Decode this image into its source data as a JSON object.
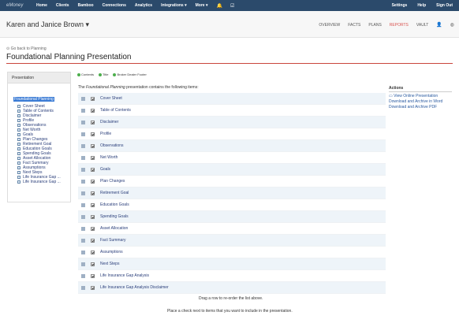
{
  "app": {
    "brand": "eMoney"
  },
  "nav": {
    "items": [
      "Home",
      "Clients",
      "Bamboo",
      "Connections",
      "Analytics",
      "Integrations ▾",
      "More ▾"
    ],
    "right": [
      "Settings",
      "Help",
      "Sign Out"
    ]
  },
  "client": {
    "name": "Karen and Janice Brown ▾",
    "tabs": [
      "OVERVIEW",
      "FACTS",
      "PLANS",
      "REPORTS",
      "VAULT"
    ],
    "active_tab": "REPORTS"
  },
  "page": {
    "back": "Go back to Planning",
    "title": "Foundational Planning Presentation"
  },
  "sidebar": {
    "heading": "Presentation",
    "root": "Foundational Planning",
    "items": [
      "Cover Sheet",
      "Table of Contents",
      "Disclaimer",
      "Profile",
      "Observations",
      "Net Worth",
      "Goals",
      "Plan Changes",
      "Retirement Goal",
      "Education Goals",
      "Spending Goals",
      "Asset Allocation",
      "Fact Summary",
      "Assumptions",
      "Next Steps",
      "Life Insurance Gap ...",
      "Life Insurance Gap ..."
    ]
  },
  "toolbar": {
    "contents": "Contents",
    "title": "Title",
    "footer": "Broker Dealer Footer"
  },
  "content": {
    "intro_pre": "The ",
    "intro_em": "Foundational Planning",
    "intro_post": " presentation contains the following items:",
    "rows": [
      "Cover Sheet",
      "Table of Contents",
      "Disclaimer",
      "Profile",
      "Observations",
      "Net Worth",
      "Goals",
      "Plan Changes",
      "Retirement Goal",
      "Education Goals",
      "Spending Goals",
      "Asset Allocation",
      "Fact Summary",
      "Assumptions",
      "Next Steps",
      "Life Insurance Gap Analysis",
      "Life Insurance Gap Analysis Disclaimer"
    ],
    "drag_note": "Drag a row to re-order the list above.",
    "check_note": "Place a check next to items that you want to include in the presentation."
  },
  "actions": {
    "heading": "Actions",
    "links": [
      "View Online Presentation",
      "Download and Archive in Word",
      "Download and Archive PDF"
    ]
  },
  "colors": {
    "nav_bg": "#2b4a6b",
    "accent": "#c9463d",
    "link": "#2a3e7a",
    "selected": "#3a7bd5"
  }
}
